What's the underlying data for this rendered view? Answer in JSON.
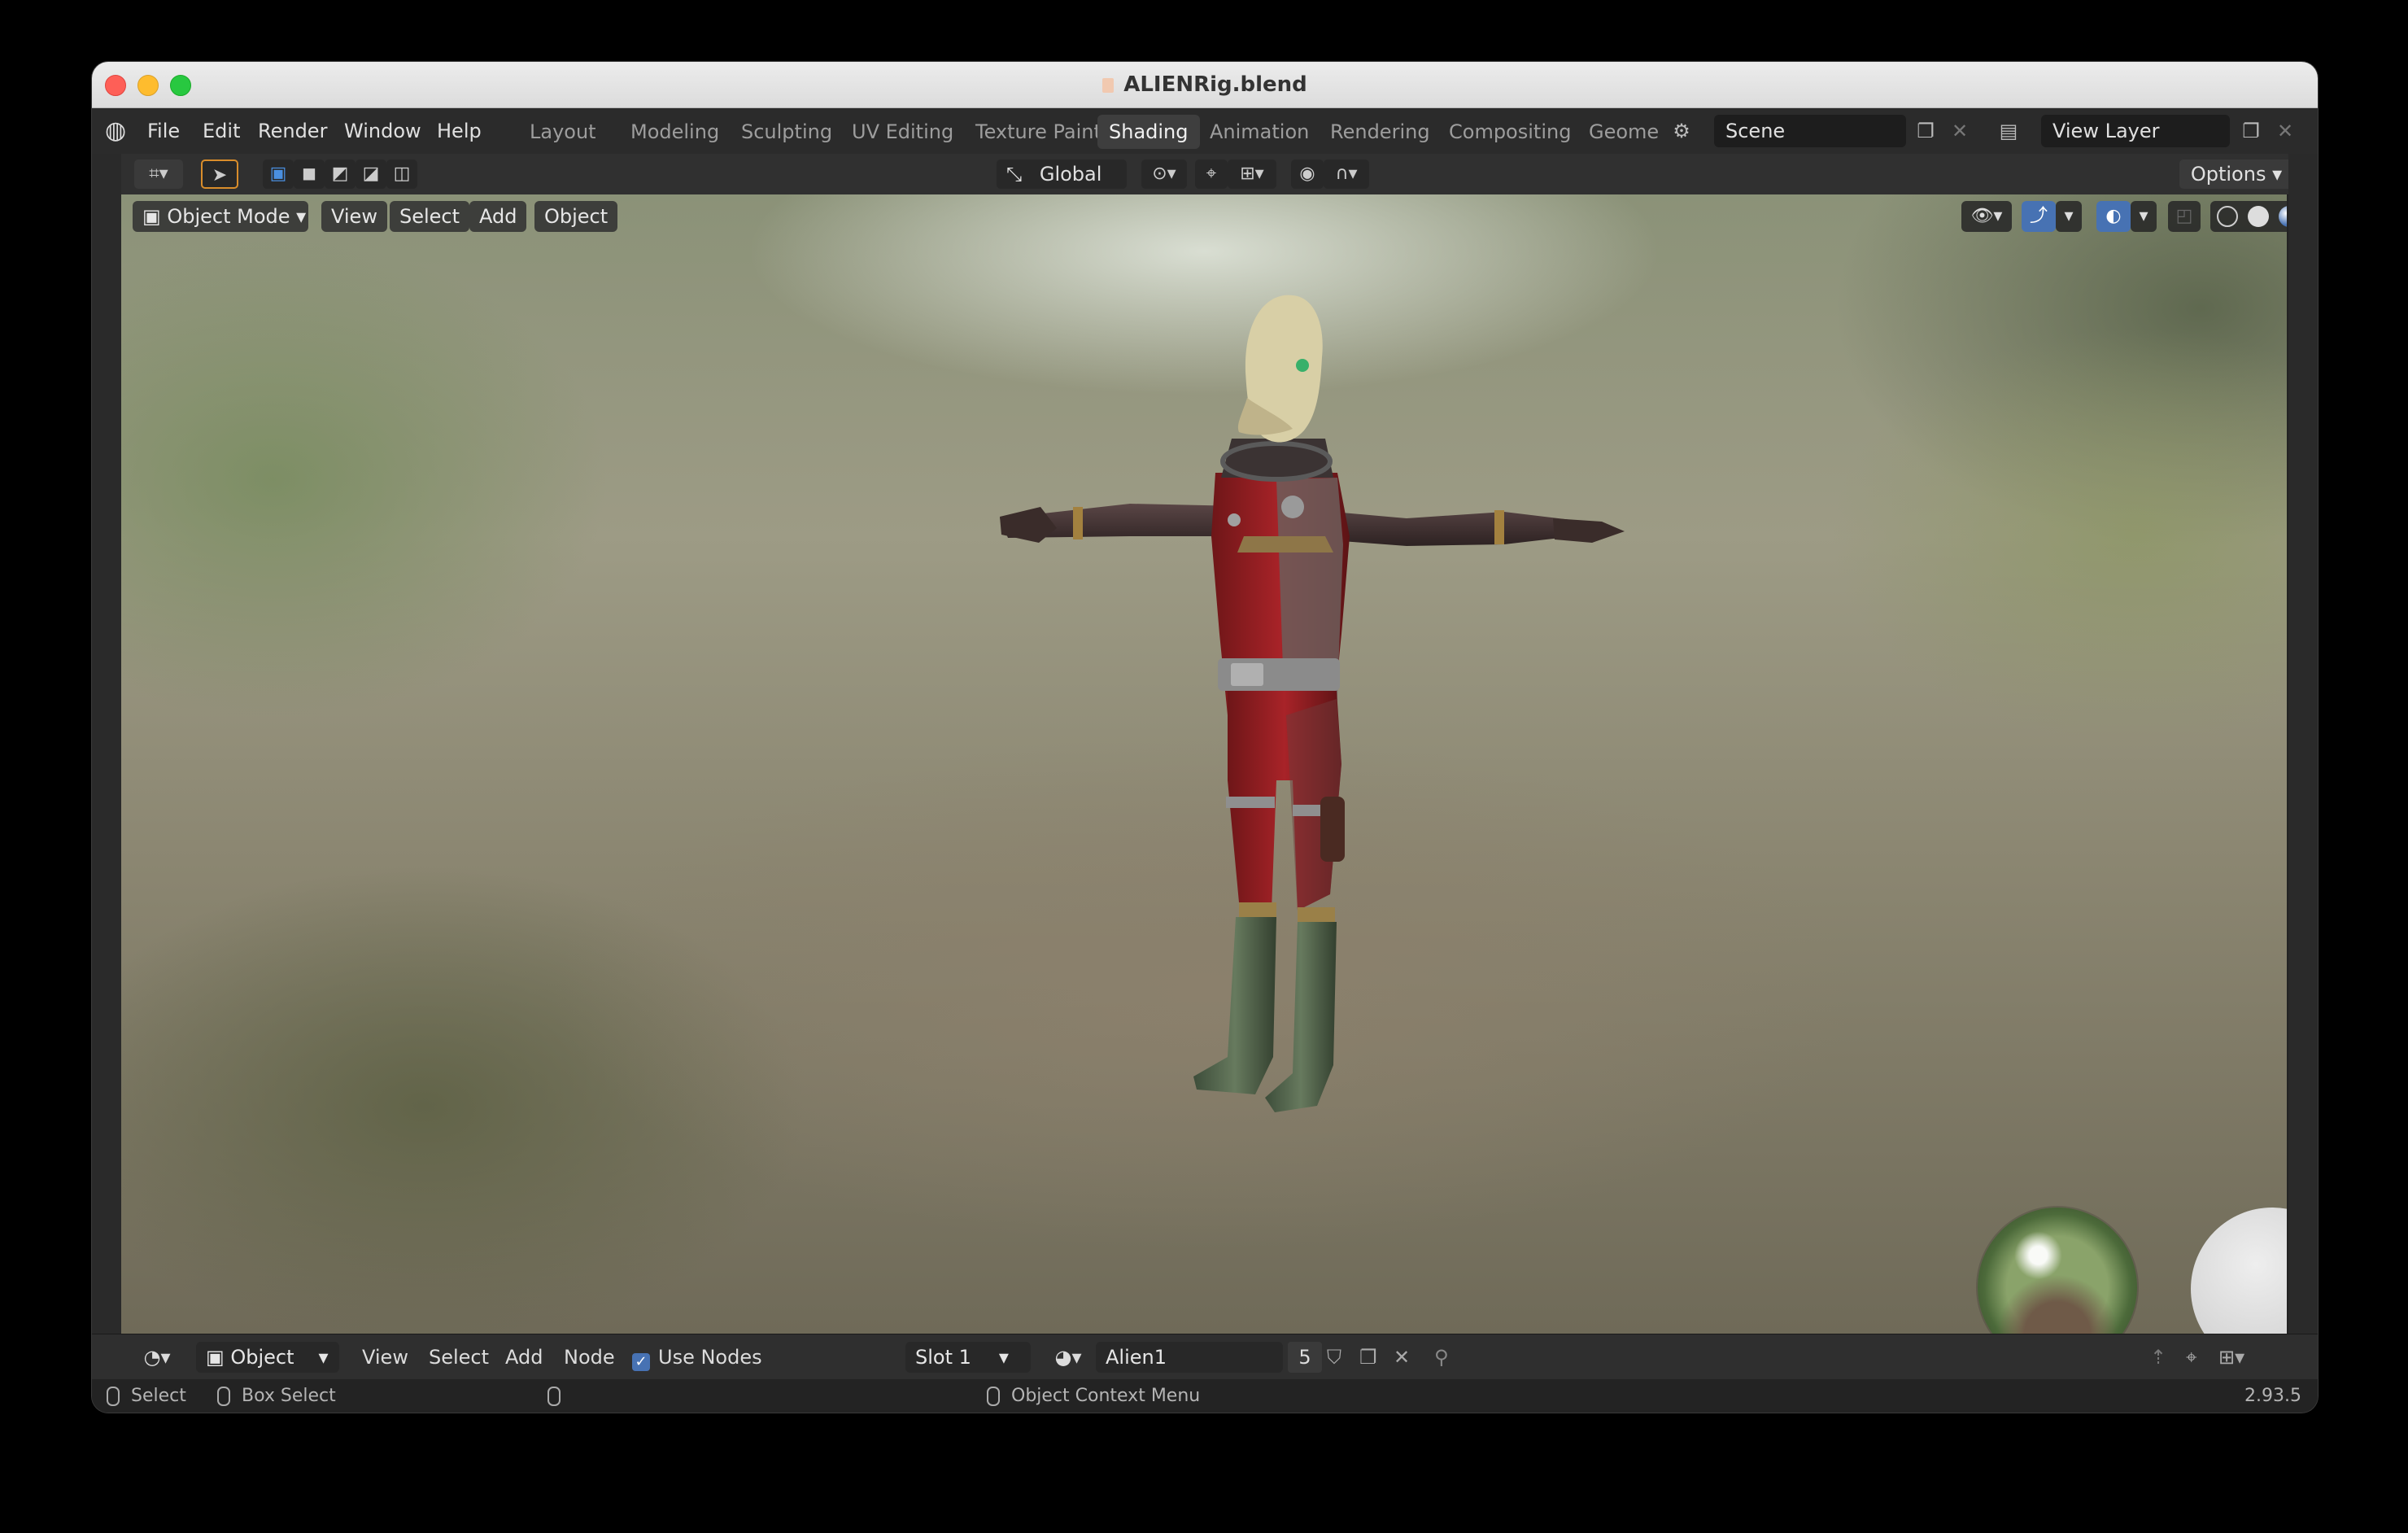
{
  "window": {
    "title": "ALIENRig.blend"
  },
  "menubar": {
    "items": [
      "File",
      "Edit",
      "Render",
      "Window",
      "Help"
    ],
    "workspace_tabs": [
      "Layout",
      "Modeling",
      "Sculpting",
      "UV Editing",
      "Texture Paint",
      "Shading",
      "Animation",
      "Rendering",
      "Compositing",
      "Geomet"
    ],
    "active_tab": "Shading",
    "scene": "Scene",
    "view_layer": "View Layer"
  },
  "toolbar": {
    "transform_orientation": "Global",
    "options_label": "Options"
  },
  "viewport": {
    "mode": "Object Mode",
    "menus": [
      "View",
      "Select",
      "Add",
      "Object"
    ]
  },
  "shader_editor": {
    "object_type": "Object",
    "menus": [
      "View",
      "Select",
      "Add",
      "Node"
    ],
    "use_nodes_label": "Use Nodes",
    "use_nodes_checked": true,
    "slot": "Slot 1",
    "material_name": "Alien1",
    "material_users": "5"
  },
  "statusbar": {
    "select": "Select",
    "box_select": "Box Select",
    "context_menu": "Object Context Menu",
    "version": "2.93.5"
  },
  "colors": {
    "accent": "#4772b3",
    "header_bg": "#303030",
    "window_bg": "#232323"
  }
}
